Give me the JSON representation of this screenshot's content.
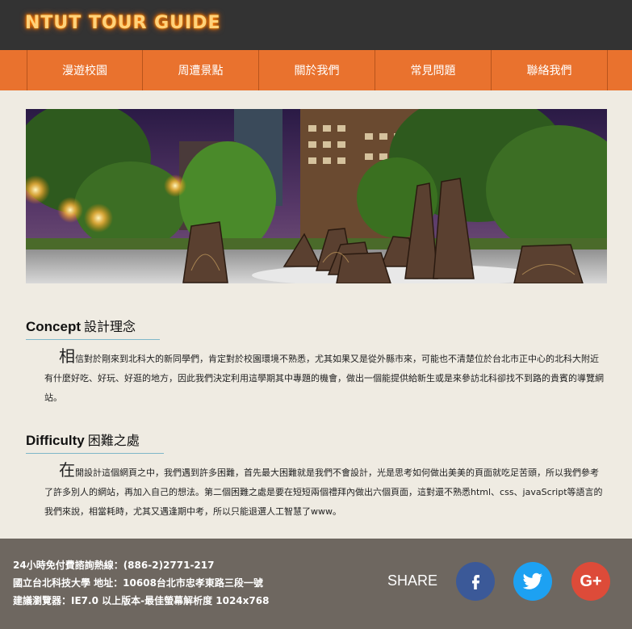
{
  "header": {
    "logo": "NTUT TOUR GUIDE"
  },
  "nav": {
    "items": [
      {
        "label": "漫遊校園"
      },
      {
        "label": "周遭景點"
      },
      {
        "label": "關於我們"
      },
      {
        "label": "常見問題"
      },
      {
        "label": "聯絡我們"
      }
    ]
  },
  "concept": {
    "title_en": "Concept",
    "title_zh": "設計理念",
    "first_char": "相",
    "body": "信對於剛來到北科大的新同學們，肯定對於校園環境不熟悉，尤其如果又是從外縣市來，可能也不清楚位於台北市正中心的北科大附近有什麼好吃、好玩、好逛的地方，因此我們決定利用這學期其中專題的機會，做出一個能提供給新生或是來參訪北科卻找不到路的貴賓的導覽網站。"
  },
  "difficulty": {
    "title_en": "Difficulty",
    "title_zh": "困難之處",
    "first_char": "在",
    "body": "開設計這個網頁之中，我們遇到許多困難，首先最大困難就是我們不會設計，光是思考如何做出美美的頁面就吃足苦頭，所以我們參考了許多別人的網站，再加入自己的想法。第二個困難之處是要在短短兩個禮拜內做出六個頁面，這對還不熟悉html、css、javaScript等語言的我們來說，相當耗時，尤其又遇逢期中考，所以只能退選人工智慧了www。"
  },
  "footer": {
    "line1": "24小時免付費諮詢熱線：(886-2)2771-217",
    "line2": "國立台北科技大學 地址：10608台北市忠孝東路三段一號",
    "line3": "建議瀏覽器：IE7.0 以上版本-最佳螢幕解析度 1024x768",
    "share_label": "SHARE",
    "social": [
      {
        "icon": "facebook-icon",
        "glyph": "f",
        "color": "#3b5998"
      },
      {
        "icon": "twitter-icon",
        "color": "#1da1f2"
      },
      {
        "icon": "google-plus-icon",
        "glyph": "G+",
        "color": "#dd4b39"
      }
    ]
  }
}
